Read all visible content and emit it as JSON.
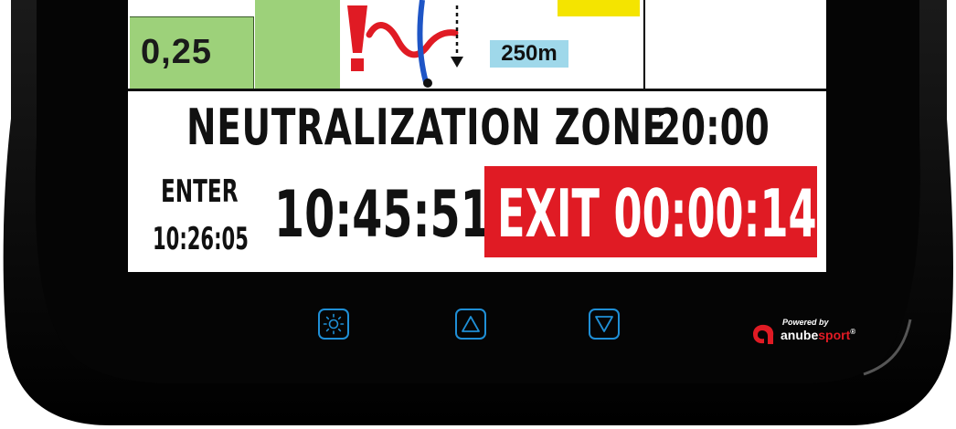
{
  "colors": {
    "device_body": "#0b0b0b",
    "screen_bg": "#ffffff",
    "exit_red": "#e01b24",
    "value_green": "#9dd17a",
    "distance_blue": "#9fd8ea",
    "button_blue": "#1f8fd6",
    "tag_yellow": "#f4e400"
  },
  "roadbook": {
    "value": "0,25",
    "distance": "250m",
    "icons": [
      "danger-exclamation-icon",
      "road-curve-icon",
      "downward-arrow-icon"
    ]
  },
  "neutralization": {
    "title": "NEUTRALIZATION ZONE",
    "duration": "20:00",
    "enter_label": "ENTER",
    "enter_time": "10:26:05",
    "current_time": "10:45:51",
    "exit_text": "EXIT 00:00:14"
  },
  "hardware_buttons": [
    {
      "name": "brightness",
      "icon": "brightness-icon"
    },
    {
      "name": "up",
      "icon": "triangle-up-icon"
    },
    {
      "name": "down",
      "icon": "triangle-down-icon"
    }
  ],
  "brand": {
    "powered_by": "Powered by",
    "name_part1": "anube",
    "name_part2": "sport",
    "registered": "®"
  }
}
